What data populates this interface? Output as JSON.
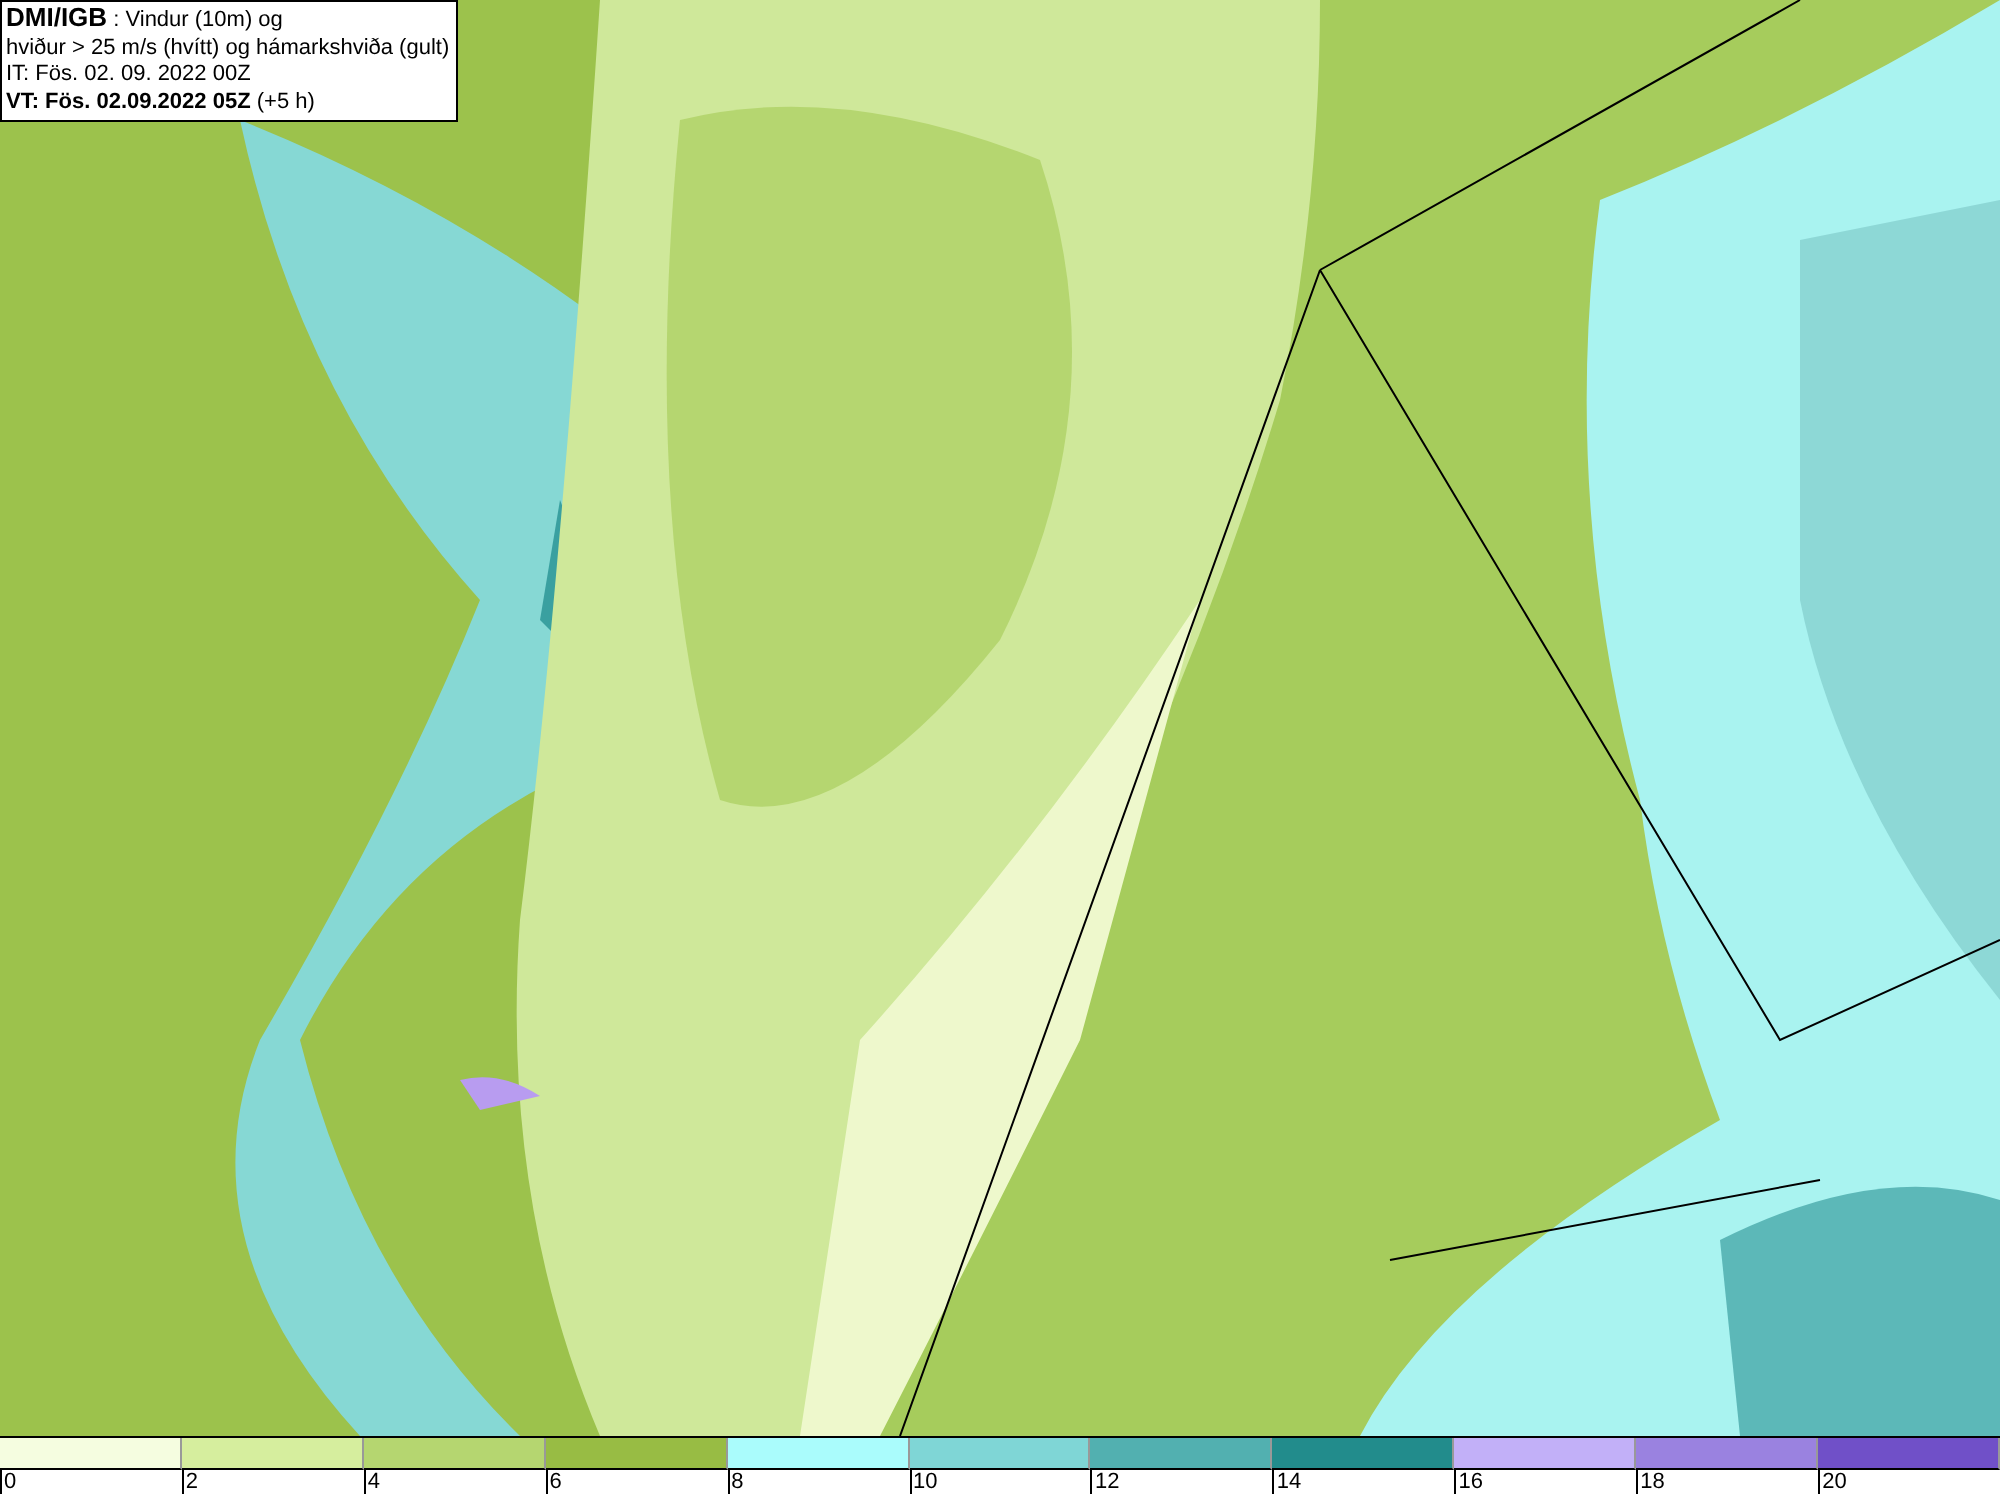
{
  "info_box": {
    "lines": [
      "**DMI/IGB** : Vindur (10m) og",
      "hviður > 25 m/s (hvítt) og hámarkshviða (gult)",
      "IT: Fös. 02. 09. 2022 00Z",
      "**VT: Fös. 02.09.2022 05Z** (+5 h)"
    ]
  },
  "color_scale": [
    {
      "label": "0",
      "color": "#f5fde0"
    },
    {
      "label": "2",
      "color": "#d6ee9e"
    },
    {
      "label": "4",
      "color": "#b5d670"
    },
    {
      "label": "6",
      "color": "#98bc44"
    },
    {
      "label": "8",
      "color": "#aafcfc"
    },
    {
      "label": "10",
      "color": "#7fd6d6"
    },
    {
      "label": "12",
      "color": "#52b0b0"
    },
    {
      "label": "14",
      "color": "#228c8c"
    },
    {
      "label": "16",
      "color": "#c2b0f8"
    },
    {
      "label": "18",
      "color": "#9a82e0"
    },
    {
      "label": "20",
      "color": "#7050c8"
    }
  ]
}
